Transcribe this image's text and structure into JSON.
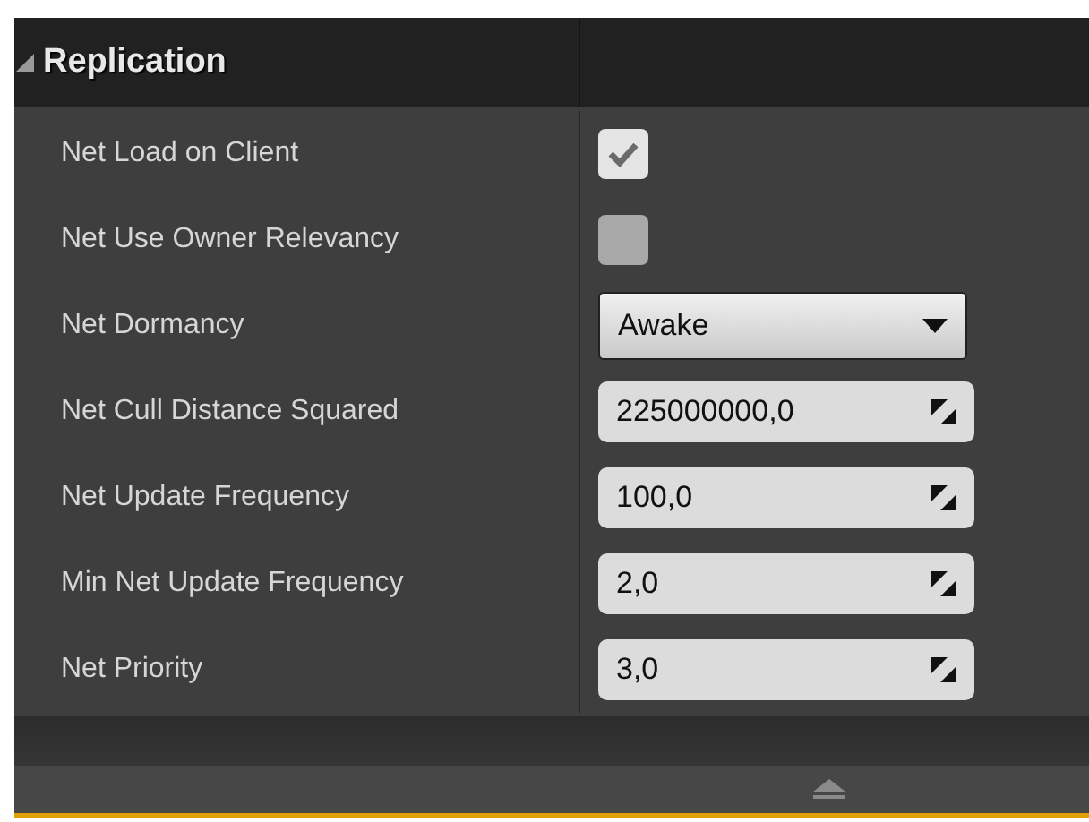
{
  "section": {
    "title": "Replication",
    "expanded": true
  },
  "properties": [
    {
      "kind": "checkbox",
      "label": "Net Load on Client",
      "checked": true
    },
    {
      "kind": "checkbox",
      "label": "Net Use Owner Relevancy",
      "checked": false
    },
    {
      "kind": "dropdown",
      "label": "Net Dormancy",
      "value": "Awake"
    },
    {
      "kind": "number",
      "label": "Net Cull Distance Squared",
      "value": "225000000,0"
    },
    {
      "kind": "number",
      "label": "Net Update Frequency",
      "value": "100,0"
    },
    {
      "kind": "number",
      "label": "Min Net Update Frequency",
      "value": "2,0"
    },
    {
      "kind": "number",
      "label": "Net Priority",
      "value": "3,0"
    }
  ]
}
